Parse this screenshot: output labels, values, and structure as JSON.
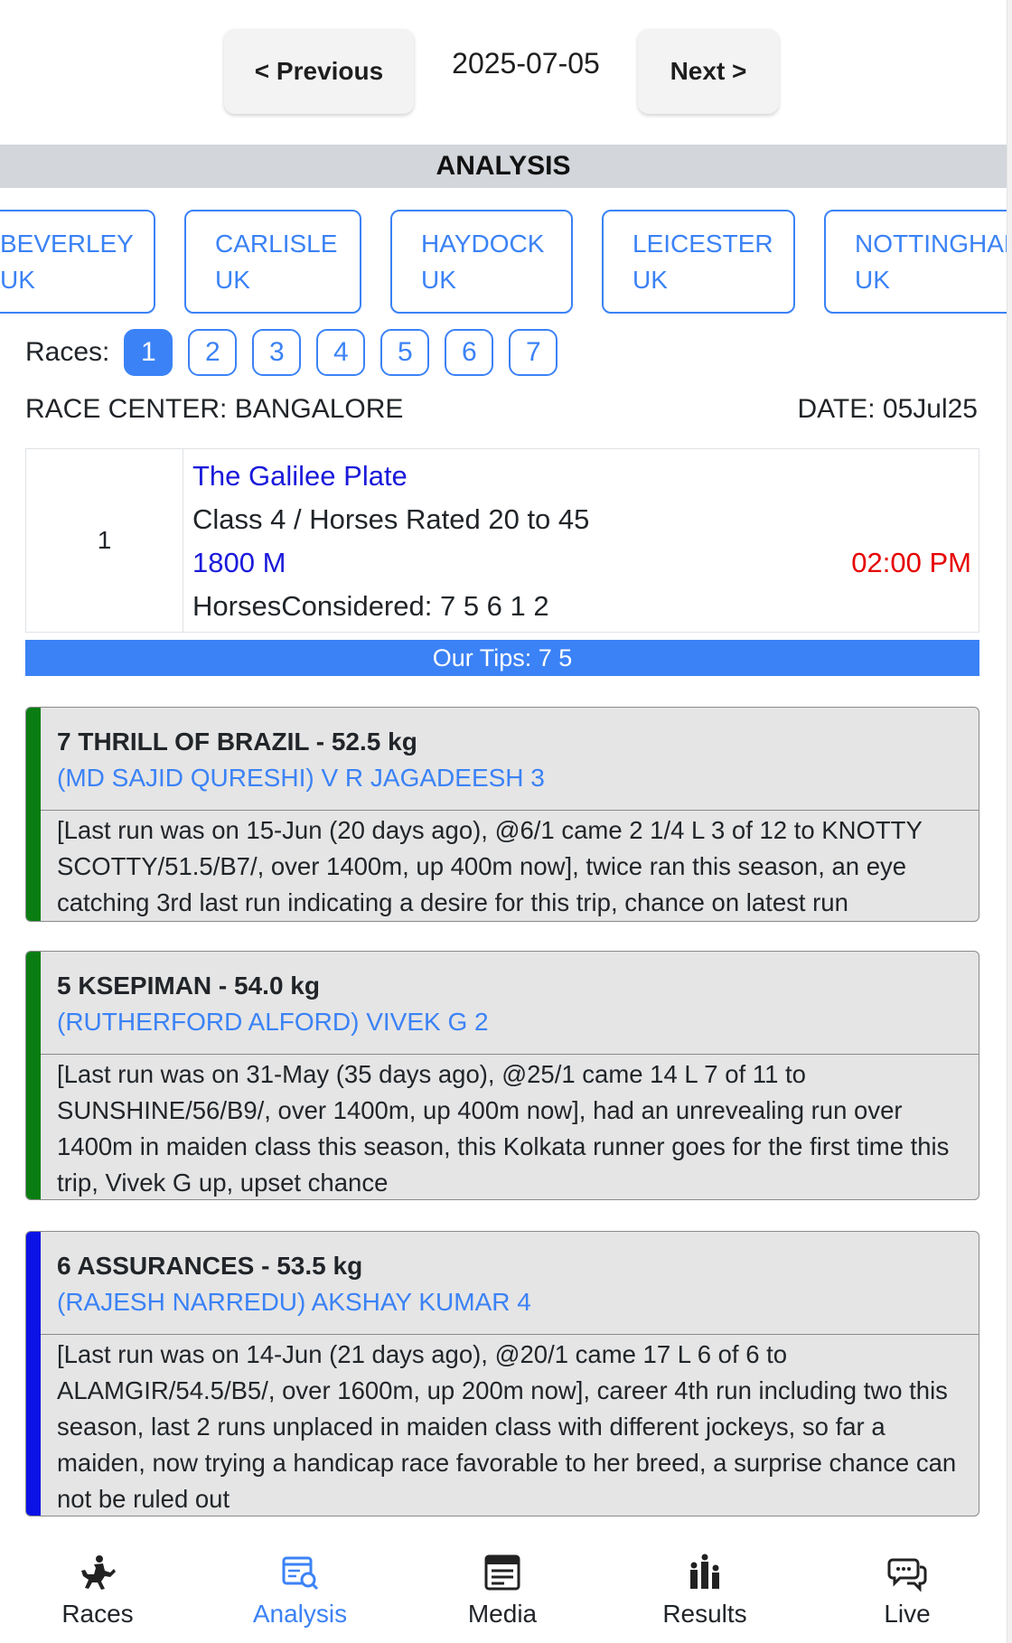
{
  "date_nav": {
    "previous_label": "< Previous",
    "date": "2025-07-05",
    "next_label": "Next >"
  },
  "section_title": "ANALYSIS",
  "venues": [
    {
      "name": "BEVERLEY",
      "country": "UK"
    },
    {
      "name": "CARLISLE",
      "country": "UK"
    },
    {
      "name": "HAYDOCK",
      "country": "UK"
    },
    {
      "name": "LEICESTER",
      "country": "UK"
    },
    {
      "name": "NOTTINGHAM",
      "country": "UK"
    }
  ],
  "races": {
    "label": "Races:",
    "numbers": [
      "1",
      "2",
      "3",
      "4",
      "5",
      "6",
      "7"
    ],
    "active": "1"
  },
  "race_center": "RACE CENTER: BANGALORE",
  "race_date": "DATE: 05Jul25",
  "race": {
    "number": "1",
    "name": "The Galilee Plate",
    "class": "Class 4 / Horses Rated 20 to 45",
    "distance": "1800 M",
    "time": "02:00 PM",
    "horses_considered": "HorsesConsidered: 7 5 6 1 2"
  },
  "tips": "Our Tips: 7 5",
  "horses": [
    {
      "title": "7 THRILL OF BRAZIL - 52.5 kg",
      "jockey": "(MD SAJID QURESHI) V R JAGADEESH 3",
      "comment": "[Last run was on 15-Jun (20 days ago), @6/1 came 2 1/4 L 3 of 12 to KNOTTY SCOTTY/51.5/B7/, over 1400m, up 400m now], twice ran this season, an eye catching 3rd last run indicating a desire for this trip, chance on latest run",
      "stripe_color": "#0a7d12"
    },
    {
      "title": "5 KSEPIMAN - 54.0 kg",
      "jockey": "(RUTHERFORD ALFORD) VIVEK G 2",
      "comment": "[Last run was on 31-May (35 days ago), @25/1 came 14 L 7 of 11 to SUNSHINE/56/B9/, over 1400m, up 400m now], had an unrevealing run over 1400m in maiden class this season, this Kolkata runner goes for the first time this trip, Vivek G up, upset chance",
      "stripe_color": "#0a7d12"
    },
    {
      "title": "6 ASSURANCES - 53.5 kg",
      "jockey": "(RAJESH NARREDU) AKSHAY KUMAR 4",
      "comment": "[Last run was on 14-Jun (21 days ago), @20/1 came 17 L 6 of 6 to ALAMGIR/54.5/B5/, over 1600m, up 200m now], career 4th run including two this season, last 2 runs unplaced in maiden class with different jockeys, so far a maiden, now trying a handicap race favorable to her breed, a surprise chance can not be ruled out",
      "stripe_color": "#0b12e6"
    }
  ],
  "bottom_nav": [
    {
      "label": "Races",
      "icon": "horse-racing-icon"
    },
    {
      "label": "Analysis",
      "icon": "analysis-icon",
      "active": true
    },
    {
      "label": "Media",
      "icon": "newspaper-icon"
    },
    {
      "label": "Results",
      "icon": "results-podium-icon"
    },
    {
      "label": "Live",
      "icon": "chat-bubbles-icon"
    }
  ],
  "colors": {
    "accent": "#3b82f6",
    "race_name": "#1a1adb",
    "time": "#e60000",
    "header_bar": "#d3d6db"
  }
}
